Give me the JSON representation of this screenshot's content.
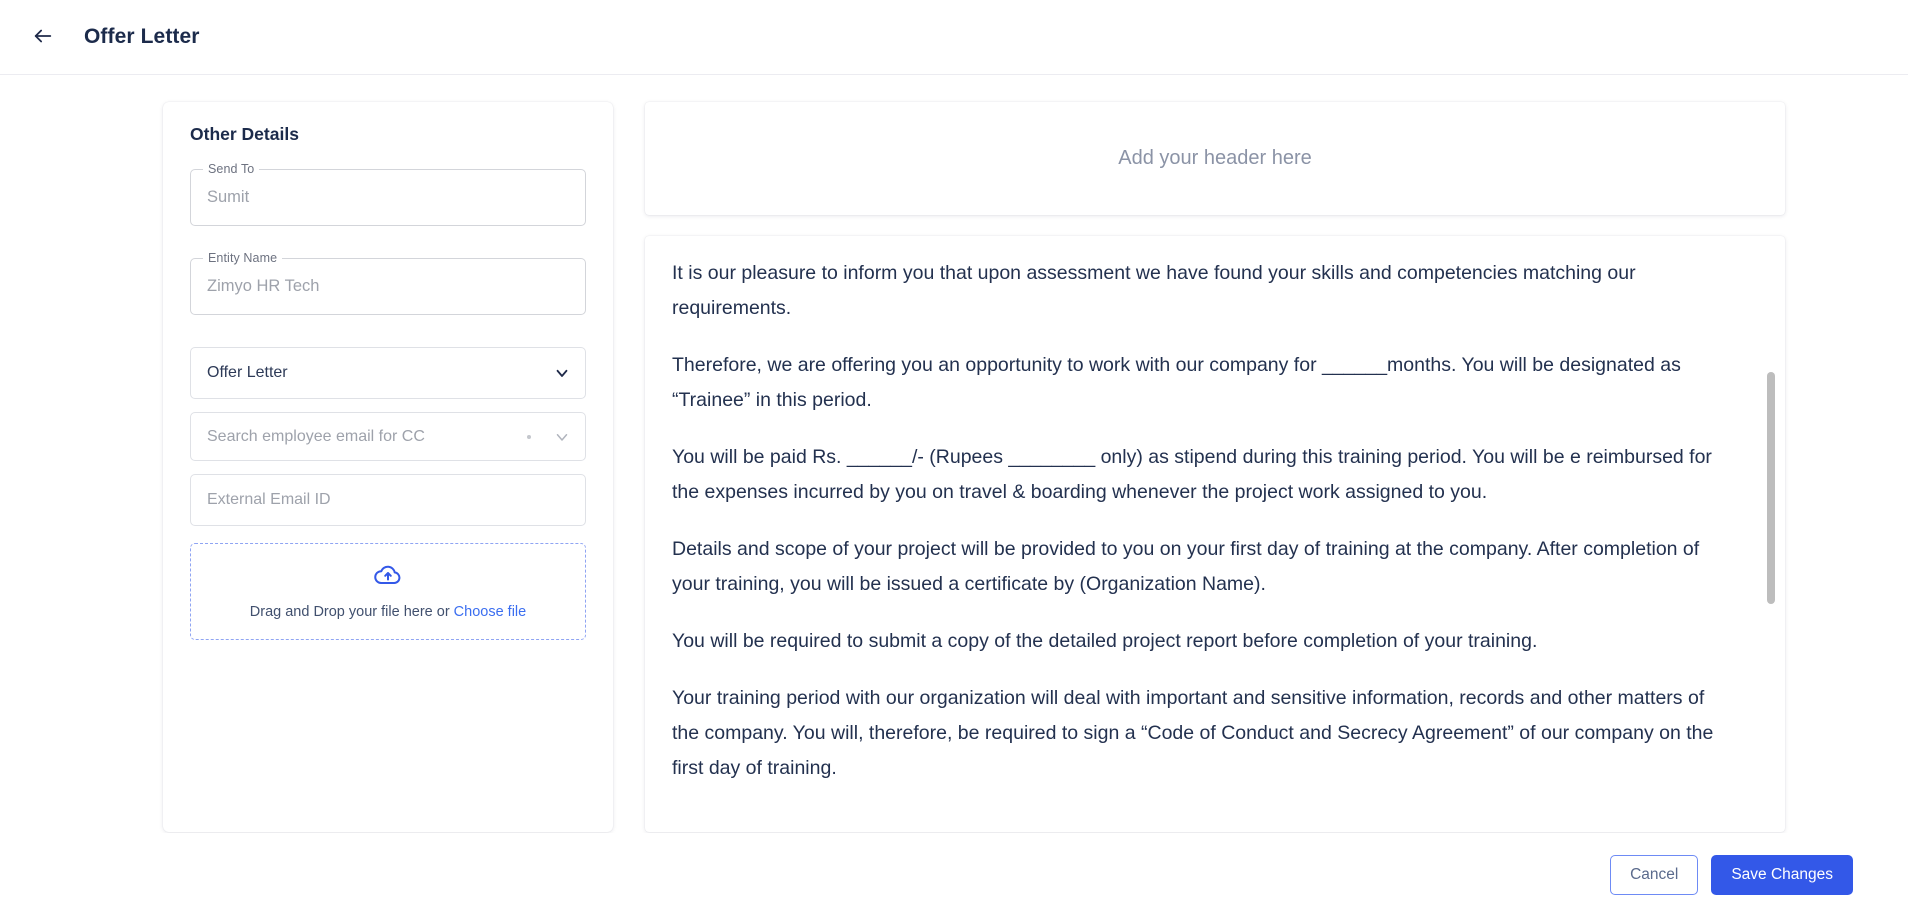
{
  "topbar": {
    "back_icon": "arrow-left-icon",
    "title": "Offer Letter"
  },
  "sidebar": {
    "title": "Other Details",
    "fields": [
      {
        "label": "Send To",
        "value": "Sumit"
      },
      {
        "label": "Entity Name",
        "value": "Zimyo HR Tech"
      }
    ],
    "document_type_select": {
      "value": "Offer Letter",
      "icon": "chevron-down-icon"
    },
    "cc_select": {
      "placeholder": "Search employee email for CC",
      "icon": "chevron-down-icon"
    },
    "external_email": {
      "placeholder": "External Email ID"
    },
    "dropzone": {
      "icon": "cloud-upload-icon",
      "text": "Drag and Drop your file here or ",
      "link": "Choose file"
    }
  },
  "document": {
    "header_placeholder": "Add your header here",
    "paragraphs": [
      "It is our pleasure to inform you that upon assessment we have found your skills and competencies matching our requirements.",
      "Therefore, we are offering you an opportunity to work with our company for ______months. You will be designated as “Trainee” in this period.",
      "You will be paid Rs. ______/- (Rupees ________ only) as stipend during this training period. You will be e reimbursed for the expenses incurred by you on travel & boarding whenever the project work assigned to you.",
      "Details and scope of your project will be provided to you on your first day of training at the company. After completion of your training, you will be issued a certificate by (Organization Name).",
      "You will be required to submit a copy of the detailed project report before completion of your training.",
      "Your training period with our organization will deal with important and sensitive information, records and other matters of the company. You will, therefore, be required to sign a “Code of Conduct and Secrecy Agreement” of our company on the first day of training."
    ]
  },
  "footer": {
    "cancel_label": "Cancel",
    "save_label": "Save Changes"
  },
  "colors": {
    "primary": "#3358e8",
    "link": "#3b6ef0",
    "text": "#23314f",
    "muted": "#9ea2ab"
  }
}
